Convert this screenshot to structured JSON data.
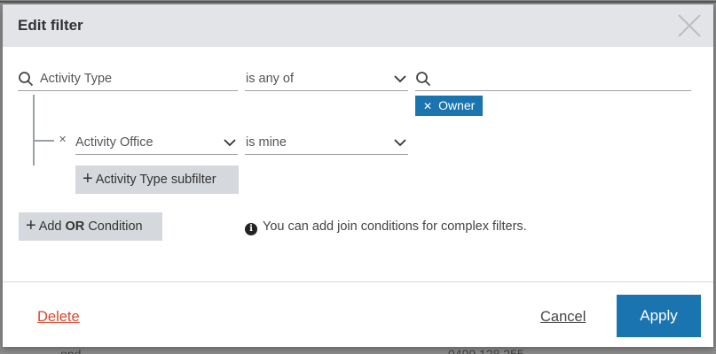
{
  "modal": {
    "title": "Edit filter"
  },
  "filter": {
    "field": "Activity Type",
    "operator": "is any of",
    "value_search": "",
    "tags": [
      "Owner"
    ]
  },
  "subfilter": {
    "field": "Activity Office",
    "operator": "is mine",
    "add_label": "Activity Type subfilter"
  },
  "add_or": {
    "prefix": "Add",
    "keyword": "OR",
    "suffix": "Condition"
  },
  "info_text": "You can add join conditions for complex filters.",
  "footer": {
    "delete_label": "Delete",
    "cancel_label": "Cancel",
    "apply_label": "Apply"
  },
  "colors": {
    "accent": "#1a74b0",
    "danger": "#d9462f",
    "header_bg": "#e2e4e8",
    "button_gray": "#d5d8dc"
  },
  "icons": [
    "close-icon",
    "search-icon",
    "chevron-down-icon",
    "plus-icon",
    "info-icon",
    "remove-icon"
  ]
}
